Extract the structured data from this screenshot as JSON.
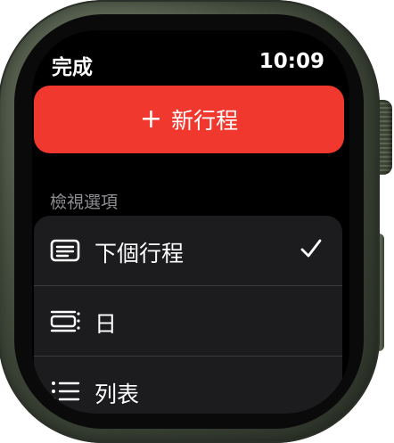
{
  "status_bar": {
    "done_label": "完成",
    "time": "10:09"
  },
  "new_event_button": {
    "icon": "plus-icon",
    "label": "新行程",
    "color": "#f0382e"
  },
  "view_options": {
    "header": "檢視選項",
    "items": [
      {
        "label": "下個行程",
        "icon": "up-next-icon",
        "selected": true
      },
      {
        "label": "日",
        "icon": "day-view-icon",
        "selected": false
      },
      {
        "label": "列表",
        "icon": "list-icon",
        "selected": false
      }
    ]
  },
  "colors": {
    "accent": "#f0382e",
    "row_background": "#1c1c1e",
    "section_header": "#8e8e93",
    "watch_case": "#4d5646"
  }
}
